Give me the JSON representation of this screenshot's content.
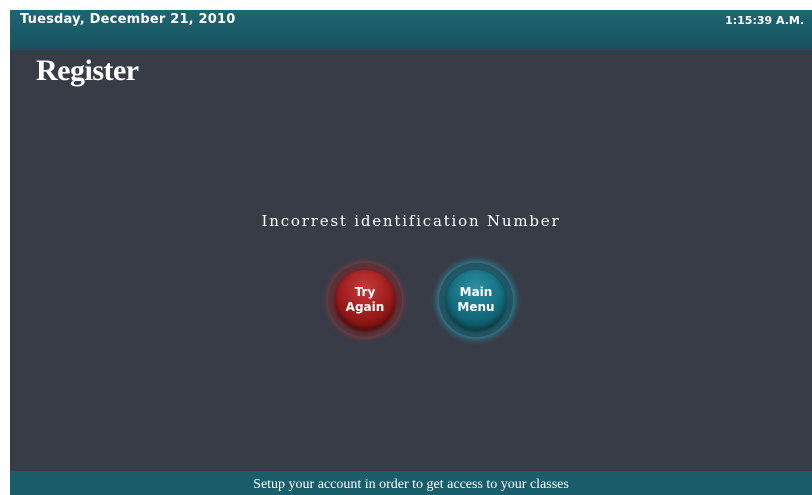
{
  "header": {
    "date": "Tuesday, December 21, 2010",
    "time": "1:15:39 A.M."
  },
  "page": {
    "title": "Register"
  },
  "main": {
    "message": "Incorrest identification Number",
    "buttons": {
      "try_again": {
        "line1": "Try",
        "line2": "Again"
      },
      "main_menu": {
        "line1": "Main",
        "line2": "Menu"
      }
    }
  },
  "footer": {
    "text": "Setup your account in order to get access to your classes"
  },
  "colors": {
    "background": "#383c47",
    "header_bar": "#1f6573",
    "footer_bar": "#1a5d6b",
    "try_again_button": "#9b1a1a",
    "main_menu_button": "#136c7e"
  }
}
